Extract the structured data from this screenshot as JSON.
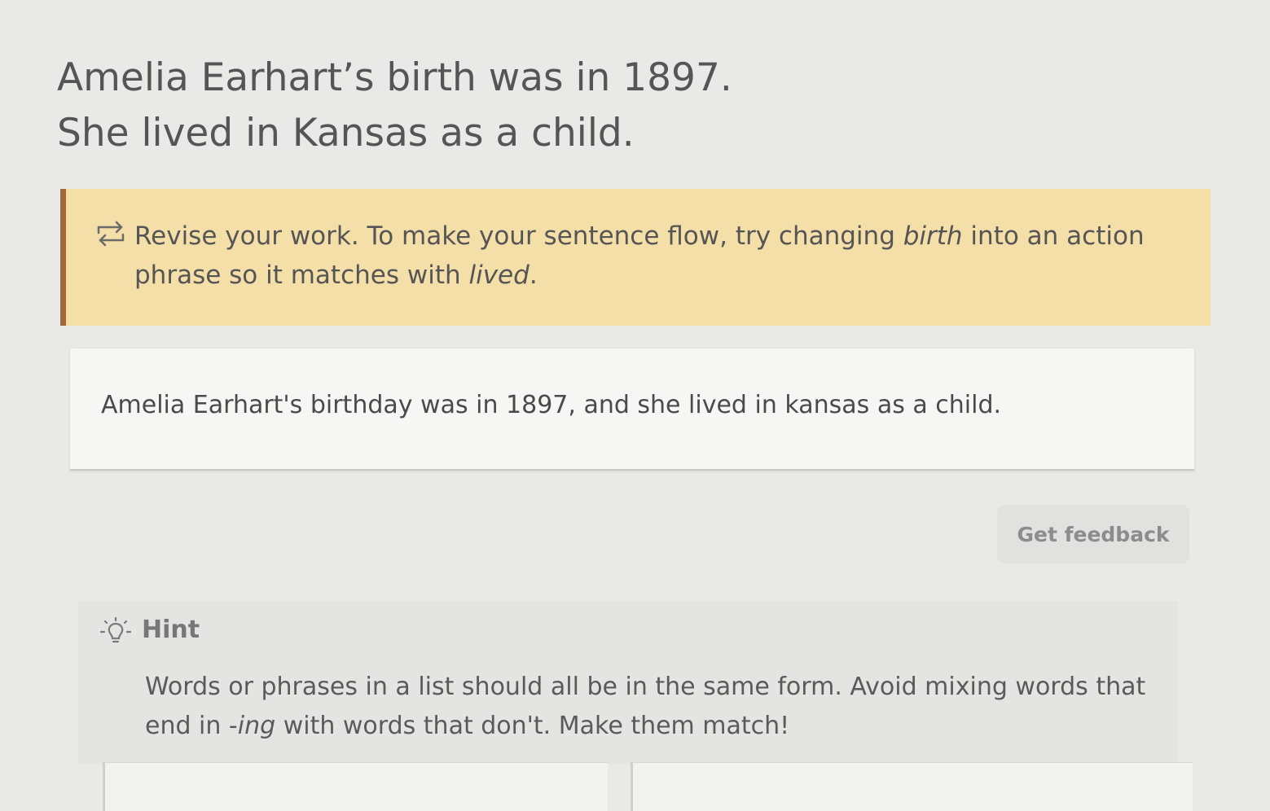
{
  "prompt": {
    "line1": "Amelia Earhart’s birth was in 1897.",
    "line2": "She lived in Kansas as a child."
  },
  "feedback": {
    "icon": "revise-arrows-icon",
    "part1": "Revise your work. To make your sentence flow, try changing ",
    "em1": "birth",
    "part2": " into an action phrase so it matches with ",
    "em2": "lived",
    "part3": "."
  },
  "response": {
    "value": "Amelia Earhart's birthday was in 1897, and she lived in kansas as a child."
  },
  "actions": {
    "get_feedback_label": "Get feedback"
  },
  "hint": {
    "icon": "lightbulb-icon",
    "title": "Hint",
    "part1": "Words or phrases in a list should all be in the same form. Avoid mixing words that end in -",
    "em1": "ing",
    "part2": " with words that don't. Make them match!"
  },
  "colors": {
    "banner_background": "#f4dfa8",
    "banner_accent": "#a0673a",
    "page_background": "#e9e9e7"
  }
}
